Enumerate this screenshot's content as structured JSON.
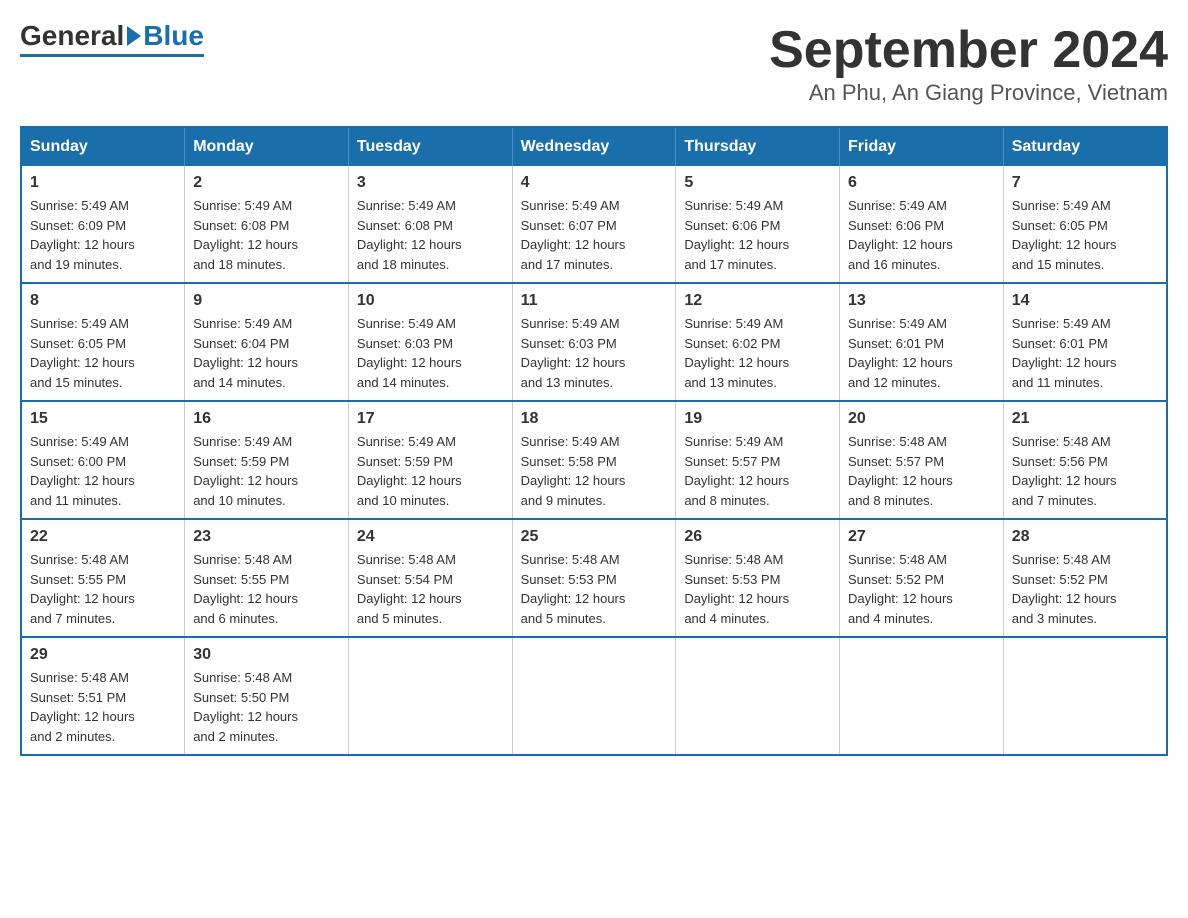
{
  "logo": {
    "general": "General",
    "blue": "Blue"
  },
  "title": "September 2024",
  "subtitle": "An Phu, An Giang Province, Vietnam",
  "weekdays": [
    "Sunday",
    "Monday",
    "Tuesday",
    "Wednesday",
    "Thursday",
    "Friday",
    "Saturday"
  ],
  "weeks": [
    [
      {
        "day": "1",
        "sunrise": "5:49 AM",
        "sunset": "6:09 PM",
        "daylight": "12 hours and 19 minutes."
      },
      {
        "day": "2",
        "sunrise": "5:49 AM",
        "sunset": "6:08 PM",
        "daylight": "12 hours and 18 minutes."
      },
      {
        "day": "3",
        "sunrise": "5:49 AM",
        "sunset": "6:08 PM",
        "daylight": "12 hours and 18 minutes."
      },
      {
        "day": "4",
        "sunrise": "5:49 AM",
        "sunset": "6:07 PM",
        "daylight": "12 hours and 17 minutes."
      },
      {
        "day": "5",
        "sunrise": "5:49 AM",
        "sunset": "6:06 PM",
        "daylight": "12 hours and 17 minutes."
      },
      {
        "day": "6",
        "sunrise": "5:49 AM",
        "sunset": "6:06 PM",
        "daylight": "12 hours and 16 minutes."
      },
      {
        "day": "7",
        "sunrise": "5:49 AM",
        "sunset": "6:05 PM",
        "daylight": "12 hours and 15 minutes."
      }
    ],
    [
      {
        "day": "8",
        "sunrise": "5:49 AM",
        "sunset": "6:05 PM",
        "daylight": "12 hours and 15 minutes."
      },
      {
        "day": "9",
        "sunrise": "5:49 AM",
        "sunset": "6:04 PM",
        "daylight": "12 hours and 14 minutes."
      },
      {
        "day": "10",
        "sunrise": "5:49 AM",
        "sunset": "6:03 PM",
        "daylight": "12 hours and 14 minutes."
      },
      {
        "day": "11",
        "sunrise": "5:49 AM",
        "sunset": "6:03 PM",
        "daylight": "12 hours and 13 minutes."
      },
      {
        "day": "12",
        "sunrise": "5:49 AM",
        "sunset": "6:02 PM",
        "daylight": "12 hours and 13 minutes."
      },
      {
        "day": "13",
        "sunrise": "5:49 AM",
        "sunset": "6:01 PM",
        "daylight": "12 hours and 12 minutes."
      },
      {
        "day": "14",
        "sunrise": "5:49 AM",
        "sunset": "6:01 PM",
        "daylight": "12 hours and 11 minutes."
      }
    ],
    [
      {
        "day": "15",
        "sunrise": "5:49 AM",
        "sunset": "6:00 PM",
        "daylight": "12 hours and 11 minutes."
      },
      {
        "day": "16",
        "sunrise": "5:49 AM",
        "sunset": "5:59 PM",
        "daylight": "12 hours and 10 minutes."
      },
      {
        "day": "17",
        "sunrise": "5:49 AM",
        "sunset": "5:59 PM",
        "daylight": "12 hours and 10 minutes."
      },
      {
        "day": "18",
        "sunrise": "5:49 AM",
        "sunset": "5:58 PM",
        "daylight": "12 hours and 9 minutes."
      },
      {
        "day": "19",
        "sunrise": "5:49 AM",
        "sunset": "5:57 PM",
        "daylight": "12 hours and 8 minutes."
      },
      {
        "day": "20",
        "sunrise": "5:48 AM",
        "sunset": "5:57 PM",
        "daylight": "12 hours and 8 minutes."
      },
      {
        "day": "21",
        "sunrise": "5:48 AM",
        "sunset": "5:56 PM",
        "daylight": "12 hours and 7 minutes."
      }
    ],
    [
      {
        "day": "22",
        "sunrise": "5:48 AM",
        "sunset": "5:55 PM",
        "daylight": "12 hours and 7 minutes."
      },
      {
        "day": "23",
        "sunrise": "5:48 AM",
        "sunset": "5:55 PM",
        "daylight": "12 hours and 6 minutes."
      },
      {
        "day": "24",
        "sunrise": "5:48 AM",
        "sunset": "5:54 PM",
        "daylight": "12 hours and 5 minutes."
      },
      {
        "day": "25",
        "sunrise": "5:48 AM",
        "sunset": "5:53 PM",
        "daylight": "12 hours and 5 minutes."
      },
      {
        "day": "26",
        "sunrise": "5:48 AM",
        "sunset": "5:53 PM",
        "daylight": "12 hours and 4 minutes."
      },
      {
        "day": "27",
        "sunrise": "5:48 AM",
        "sunset": "5:52 PM",
        "daylight": "12 hours and 4 minutes."
      },
      {
        "day": "28",
        "sunrise": "5:48 AM",
        "sunset": "5:52 PM",
        "daylight": "12 hours and 3 minutes."
      }
    ],
    [
      {
        "day": "29",
        "sunrise": "5:48 AM",
        "sunset": "5:51 PM",
        "daylight": "12 hours and 2 minutes."
      },
      {
        "day": "30",
        "sunrise": "5:48 AM",
        "sunset": "5:50 PM",
        "daylight": "12 hours and 2 minutes."
      },
      null,
      null,
      null,
      null,
      null
    ]
  ],
  "labels": {
    "sunrise": "Sunrise:",
    "sunset": "Sunset:",
    "daylight": "Daylight:"
  }
}
